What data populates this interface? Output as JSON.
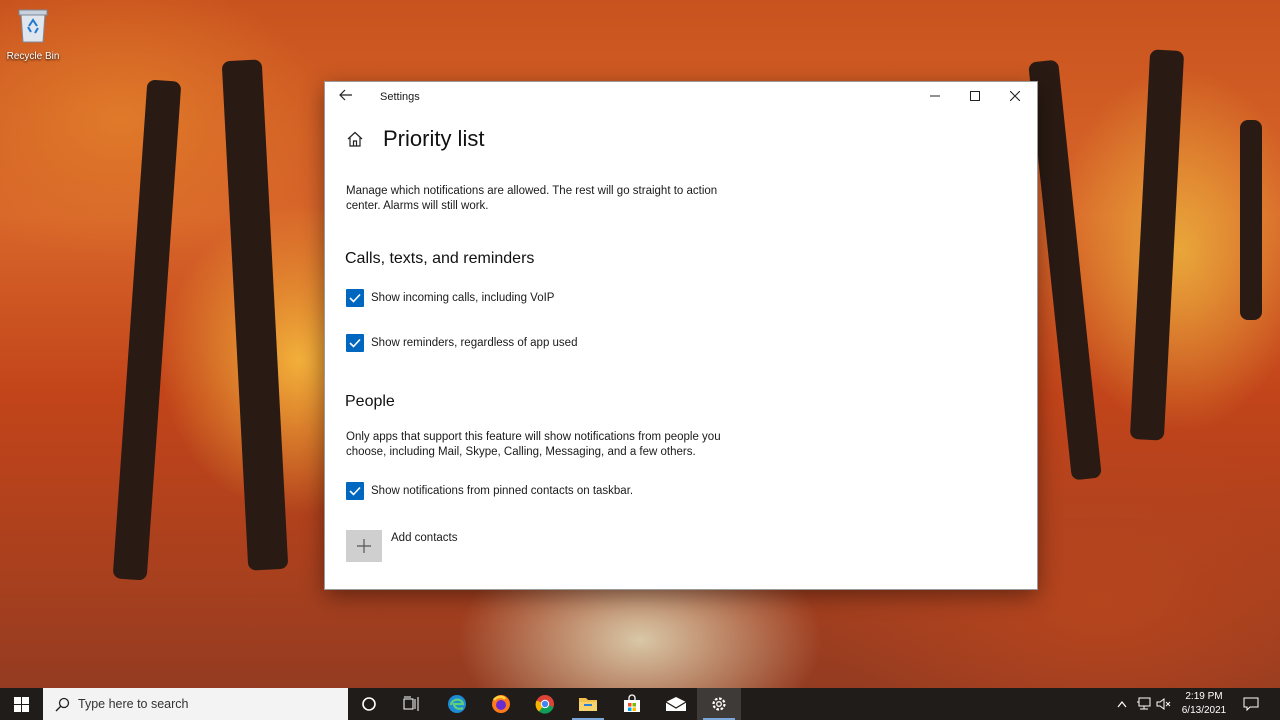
{
  "desktop": {
    "icons": [
      {
        "label": "Recycle Bin"
      }
    ]
  },
  "window": {
    "title": "Settings",
    "page_title": "Priority list",
    "description": "Manage which notifications are allowed. The rest will go straight to action center. Alarms will still work.",
    "sections": {
      "calls": {
        "heading": "Calls, texts, and reminders",
        "options": [
          {
            "label": "Show incoming calls, including VoIP",
            "checked": true
          },
          {
            "label": "Show reminders, regardless of app used",
            "checked": true
          }
        ]
      },
      "people": {
        "heading": "People",
        "description": "Only apps that support this feature will show notifications from people you choose, including Mail, Skype, Calling, Messaging, and a few others.",
        "options": [
          {
            "label": "Show notifications from pinned contacts on taskbar.",
            "checked": true
          }
        ],
        "add_contacts_label": "Add contacts"
      }
    }
  },
  "taskbar": {
    "search_placeholder": "Type here to search",
    "items": [
      "cortana-icon",
      "task-view-icon",
      "edge-icon",
      "firefox-icon",
      "chrome-icon",
      "file-explorer-icon",
      "store-icon",
      "mail-icon",
      "settings-icon"
    ],
    "active_item": "settings-icon",
    "clock": {
      "time": "2:19 PM",
      "date": "6/13/2021"
    }
  },
  "colors": {
    "accent": "#0067c0",
    "taskbar": "#201c1a",
    "window_bg": "#ffffff"
  }
}
